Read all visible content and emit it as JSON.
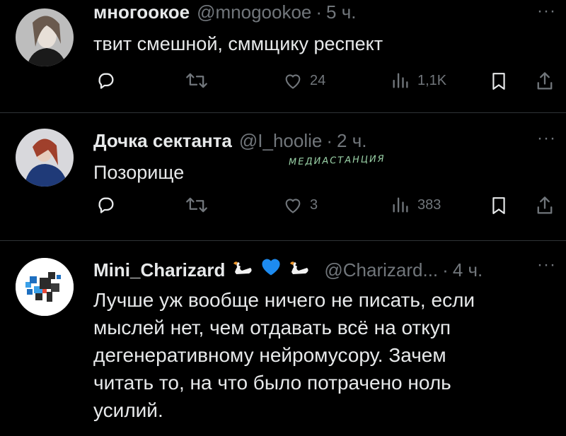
{
  "tweets": [
    {
      "display_name": "многоокое",
      "handle": "@mnogookoe",
      "separator": "·",
      "time": "5 ч.",
      "text": "твит смешной, сммщику респект",
      "likes": "24",
      "views": "1,1K",
      "more": "···"
    },
    {
      "display_name": "Дочка сектанта",
      "handle": "@I_hoolie",
      "separator": "·",
      "time": "2 ч.",
      "text": "Позорище",
      "likes": "3",
      "views": "383",
      "more": "···"
    },
    {
      "display_name": "Mini_Charizard",
      "handle": "@Charizard...",
      "separator": "·",
      "time": "4 ч.",
      "text_lines": [
        "Лучше уж вообще ничего не писать, если",
        "мыслей нет, чем отдавать всё на откуп",
        "дегенеративному нейромусору. Зачем",
        "читать то, на что было потрачено ноль",
        "усилий."
      ],
      "more": "···"
    }
  ],
  "watermark": "МЕДИАСТАНЦИЯ",
  "icons": {
    "reply": "reply-icon",
    "retweet": "retweet-icon",
    "like": "heart-icon",
    "views": "views-icon",
    "bookmark": "bookmark-icon",
    "share": "share-icon",
    "name_emojis": [
      "swan-icon",
      "blue-heart-icon",
      "swan-icon"
    ]
  },
  "colors": {
    "background": "#000000",
    "text": "#e7e9ea",
    "muted": "#71767b",
    "divider": "#2f3336",
    "blue_heart": "#1d8bf0"
  }
}
